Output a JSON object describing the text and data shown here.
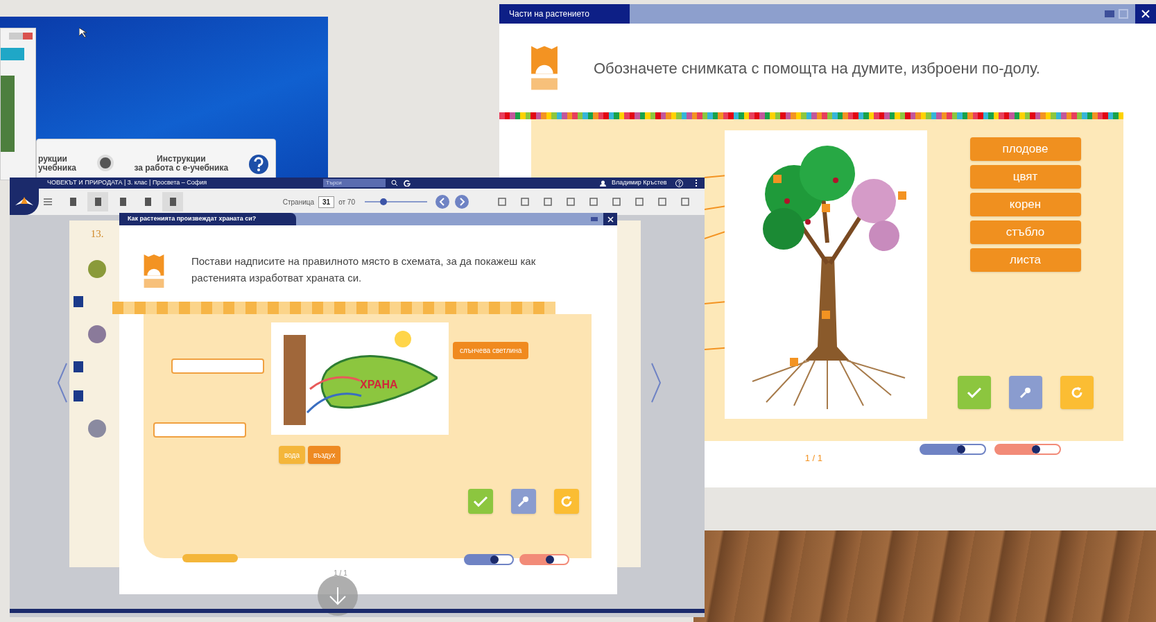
{
  "desktop": {
    "window_texts": [
      "рукции",
      "учебника"
    ],
    "instructions_title": "Инструкции",
    "instructions_subtitle": "за работа с е-учебника"
  },
  "reader": {
    "title": "ЧОВЕКЪТ И ПРИРОДАТА | 3. клас | Просвета – София",
    "search": {
      "placeholder": "Търси"
    },
    "user": "Владимир Кръстев",
    "page_label": "Страница",
    "page_value": "31",
    "page_total": "от 70",
    "zoom": {
      "level": 0.3
    },
    "book_page_number": "13.",
    "dialog": {
      "title": "Как растенията произвеждат храната си?",
      "question": "Постави надписите на правилното място в схемата, за да покажеш как растенията изработват храната си.",
      "diagram": {
        "center_label": "ХРАНА",
        "labels": [
          {
            "kind": "blank"
          },
          {
            "kind": "blank"
          },
          {
            "kind": "tag",
            "text": "слънчева светлина"
          }
        ]
      },
      "chips": [
        {
          "text": "вода",
          "selected": true
        },
        {
          "text": "въздух",
          "selected": false
        }
      ],
      "switches": [
        {
          "color": "#6f83c4",
          "on": true
        },
        {
          "color": "#f28b78",
          "on": true
        }
      ],
      "pager": "1 / 1"
    }
  },
  "exercise_window": {
    "title": "Части на растението",
    "instruction": "Обозначете снимката с помощта на думите, изброени по-долу.",
    "chips": [
      {
        "text": "плодове",
        "selected": false
      },
      {
        "text": "цвят",
        "selected": false
      },
      {
        "text": "корен",
        "selected": false
      },
      {
        "text": "стъбло",
        "selected": false
      },
      {
        "text": "листа",
        "selected": false
      }
    ],
    "switches": [
      {
        "color": "#6f83c4",
        "on": true
      },
      {
        "color": "#f28b78",
        "on": true
      }
    ],
    "pager": "1 / 1"
  }
}
